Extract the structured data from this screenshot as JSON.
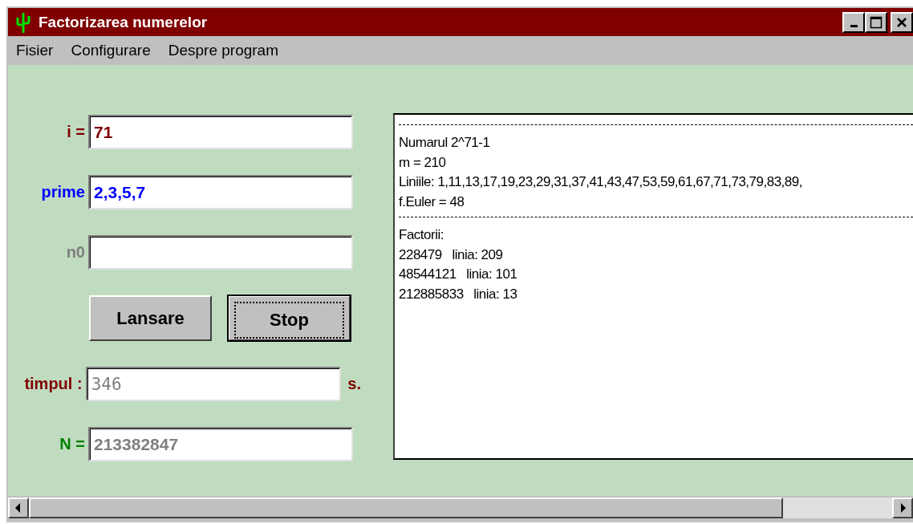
{
  "window": {
    "title": "Factorizarea numerelor"
  },
  "menu": [
    "Fisier",
    "Configurare",
    "Despre program"
  ],
  "fields": [
    {
      "label": "i =",
      "value": "71",
      "color": "#800000",
      "disabled": false
    },
    {
      "label": "prime",
      "value": "2,3,5,7",
      "color": "#0000ff",
      "disabled": false
    },
    {
      "label": "n0",
      "color": "#808080"
    },
    {
      "kind": "buttons"
    },
    {
      "label": "timpul :",
      "value": "346",
      "unit": "s.",
      "color": "#800000",
      "disabled": true
    },
    {
      "label": "N =",
      "value": "213382847",
      "color": "#008000",
      "disabled": true
    }
  ],
  "buttons": [
    {
      "label": "Lansare",
      "focused": false
    },
    {
      "label": "Stop",
      "focused": true
    }
  ],
  "output": [
    {
      "kind": "rule"
    },
    {
      "kind": "line",
      "text": "Numarul 2^71-1"
    },
    {
      "kind": "line",
      "text": "m = 210"
    },
    {
      "kind": "line",
      "text": "Liniile: 1,11,13,17,19,23,29,31,37,41,43,47,53,59,61,67,71,73,79,83,89,"
    },
    {
      "kind": "line",
      "text": "f.Euler = 48"
    },
    {
      "kind": "rule"
    },
    {
      "kind": "line",
      "text": "Factorii:"
    },
    {
      "kind": "line",
      "text": "228479   linia: 209"
    },
    {
      "kind": "line",
      "text": "48544121   linia: 101"
    },
    {
      "kind": "line",
      "text": "212885833   linia: 13"
    }
  ]
}
